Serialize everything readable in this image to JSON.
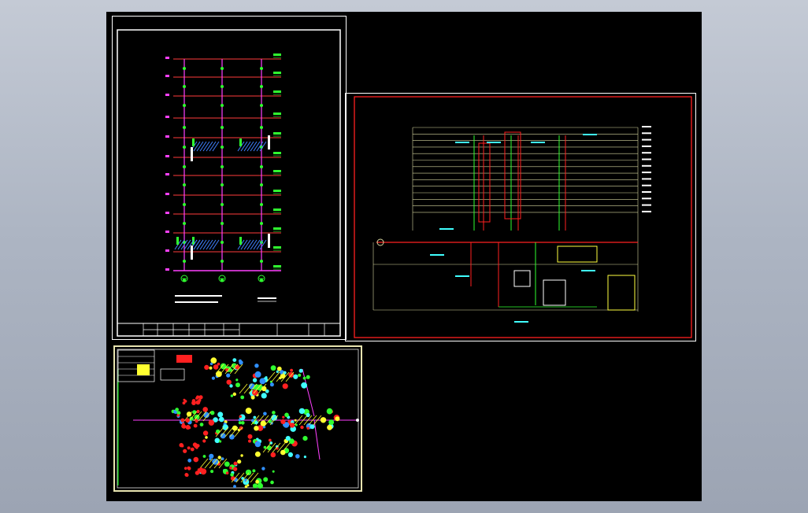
{
  "viewer": {
    "background": "#000000",
    "frame_color": "#ffffff",
    "accent_red": "#ff0000",
    "accent_magenta": "#ff00ff",
    "accent_green": "#00ff00",
    "accent_cyan": "#00ffff",
    "accent_yellow": "#ffff00"
  },
  "sheets": [
    {
      "id": "sheet-left",
      "kind": "riser-diagram",
      "title_block_cells": [
        "",
        "",
        "",
        "",
        "",
        "",
        "",
        "",
        "",
        "",
        ""
      ]
    },
    {
      "id": "sheet-right",
      "kind": "system-diagram"
    },
    {
      "id": "sheet-bottom",
      "kind": "plan-layout"
    }
  ],
  "icons": {
    "floor-marker": "circle-marker",
    "riser-tag": "green-tag"
  }
}
